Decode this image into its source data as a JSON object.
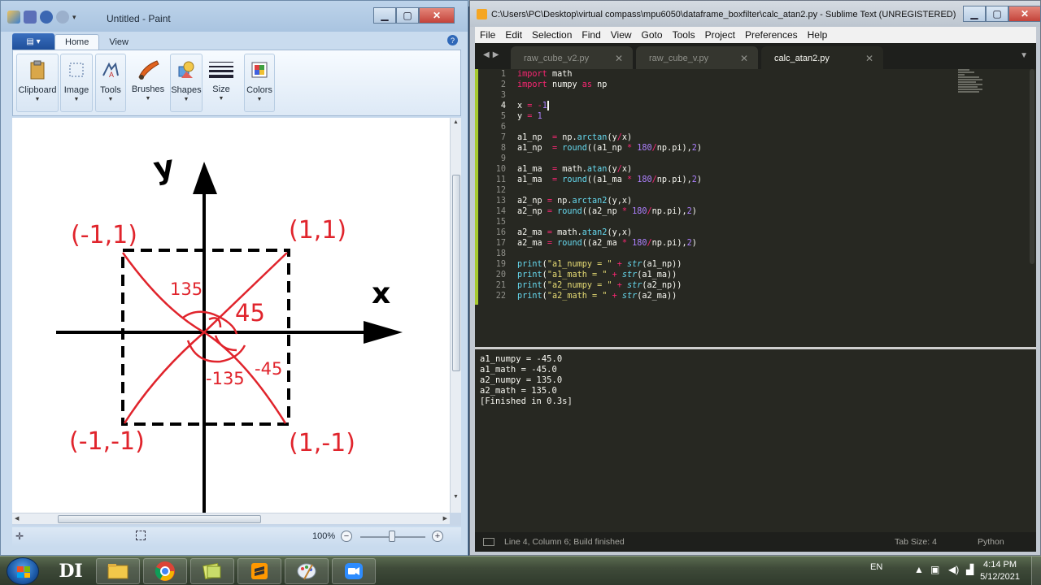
{
  "paint": {
    "title": "Untitled - Paint",
    "tabs": [
      "Home",
      "View"
    ],
    "groups": [
      {
        "label": "Clipboard"
      },
      {
        "label": "Image"
      },
      {
        "label": "Tools"
      },
      {
        "label": "Brushes"
      },
      {
        "label": "Shapes"
      },
      {
        "label": "Size"
      },
      {
        "label": "Colors"
      }
    ],
    "zoom": "100%",
    "drawing": {
      "axis_y_label": "y",
      "axis_x_label": "x",
      "corner_top_left": "(-1,1)",
      "corner_top_right": "(1,1)",
      "corner_bottom_left": "(-1,-1)",
      "corner_bottom_right": "(1,-1)",
      "angle_135": "135",
      "angle_45": "45",
      "angle_neg135": "-135",
      "angle_neg45": "-45"
    }
  },
  "sublime": {
    "title": "C:\\Users\\PC\\Desktop\\virtual compass\\mpu6050\\dataframe_boxfilter\\calc_atan2.py - Sublime Text (UNREGISTERED)",
    "menu": [
      "File",
      "Edit",
      "Selection",
      "Find",
      "View",
      "Goto",
      "Tools",
      "Project",
      "Preferences",
      "Help"
    ],
    "tabs": [
      "raw_cube_v2.py",
      "raw_cube_v.py",
      "calc_atan2.py"
    ],
    "line_numbers": [
      "1",
      "2",
      "3",
      "4",
      "5",
      "6",
      "7",
      "8",
      "9",
      "10",
      "11",
      "12",
      "13",
      "14",
      "15",
      "16",
      "17",
      "18",
      "19",
      "20",
      "21",
      "22"
    ],
    "output": "a1_numpy = -45.0\na1_math = -45.0\na2_numpy = 135.0\na2_math = 135.0\n[Finished in 0.3s]",
    "status": {
      "position": "Line 4, Column 6; Build finished",
      "tab_size": "Tab Size: 4",
      "syntax": "Python"
    }
  },
  "taskbar": {
    "pinned_text": "DI",
    "language": "EN",
    "time": "4:14 PM",
    "date": "5/12/2021"
  }
}
